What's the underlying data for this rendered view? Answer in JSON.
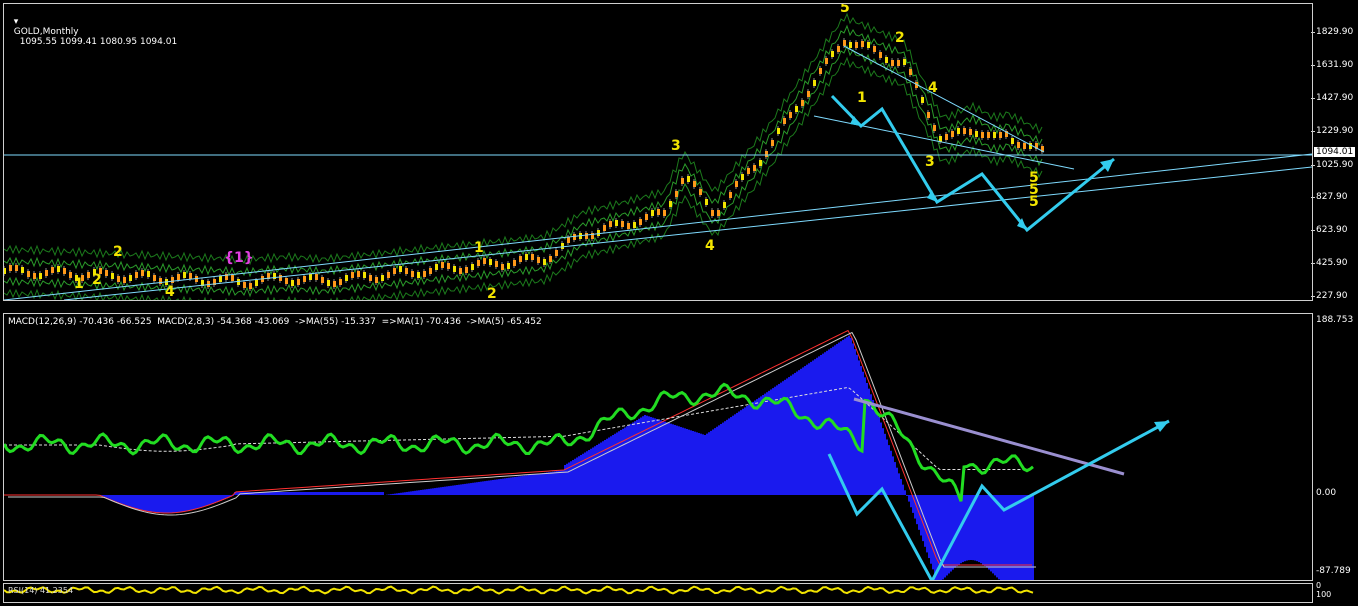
{
  "main": {
    "title": "GOLD,Monthly",
    "ohlc": "1095.55 1099.41 1080.95 1094.01",
    "current_price": "1094.01",
    "y_ticks": [
      "1829.90",
      "1631.90",
      "1427.90",
      "1229.90",
      "1025.90",
      "827.90",
      "623.90",
      "425.90",
      "227.90"
    ],
    "wave_labels": [
      {
        "t": "5",
        "c": "#f2e400"
      },
      {
        "t": "2",
        "c": "#f2e400"
      },
      {
        "t": "1",
        "c": "#f2e400"
      },
      {
        "t": "3",
        "c": "#f2e400"
      },
      {
        "t": "4",
        "c": "#f2e400"
      },
      {
        "t": "3",
        "c": "#f2e400"
      },
      {
        "t": "4",
        "c": "#f2e400"
      },
      {
        "t": "1",
        "c": "#f2e400"
      },
      {
        "t": "2",
        "c": "#f2e400"
      },
      {
        "t": "2",
        "c": "#f2e400"
      },
      {
        "t": "1",
        "c": "#f2e400"
      },
      {
        "t": "2",
        "c": "#f2e400"
      },
      {
        "t": "4",
        "c": "#f2e400"
      },
      {
        "t": "{1}",
        "c": "#e040e0"
      },
      {
        "t": "5",
        "c": "#f2e400"
      },
      {
        "t": "5",
        "c": "#f2e400"
      },
      {
        "t": "5",
        "c": "#f2e400"
      }
    ]
  },
  "macd": {
    "header": "MACD(12,26,9) -70.436 -66.525  MACD(2,8,3) -54.368 -43.069  ->MA(55) -15.337  =>MA(1) -70.436  ->MA(5) -65.452",
    "y_ticks": [
      "188.753",
      "0.00",
      "-87.789"
    ]
  },
  "rsi": {
    "header": "RSI(14) 41.2354",
    "y_ticks": [
      "0",
      "100"
    ]
  },
  "colors": {
    "price_line": "#7fdbff",
    "wave_yellow": "#f2e400",
    "wave_magenta": "#e040e0",
    "arrow": "#33ccee",
    "hist": "#1a1aee",
    "green_osc": "#22dd22",
    "trend_purple": "#9a8fd0"
  }
}
